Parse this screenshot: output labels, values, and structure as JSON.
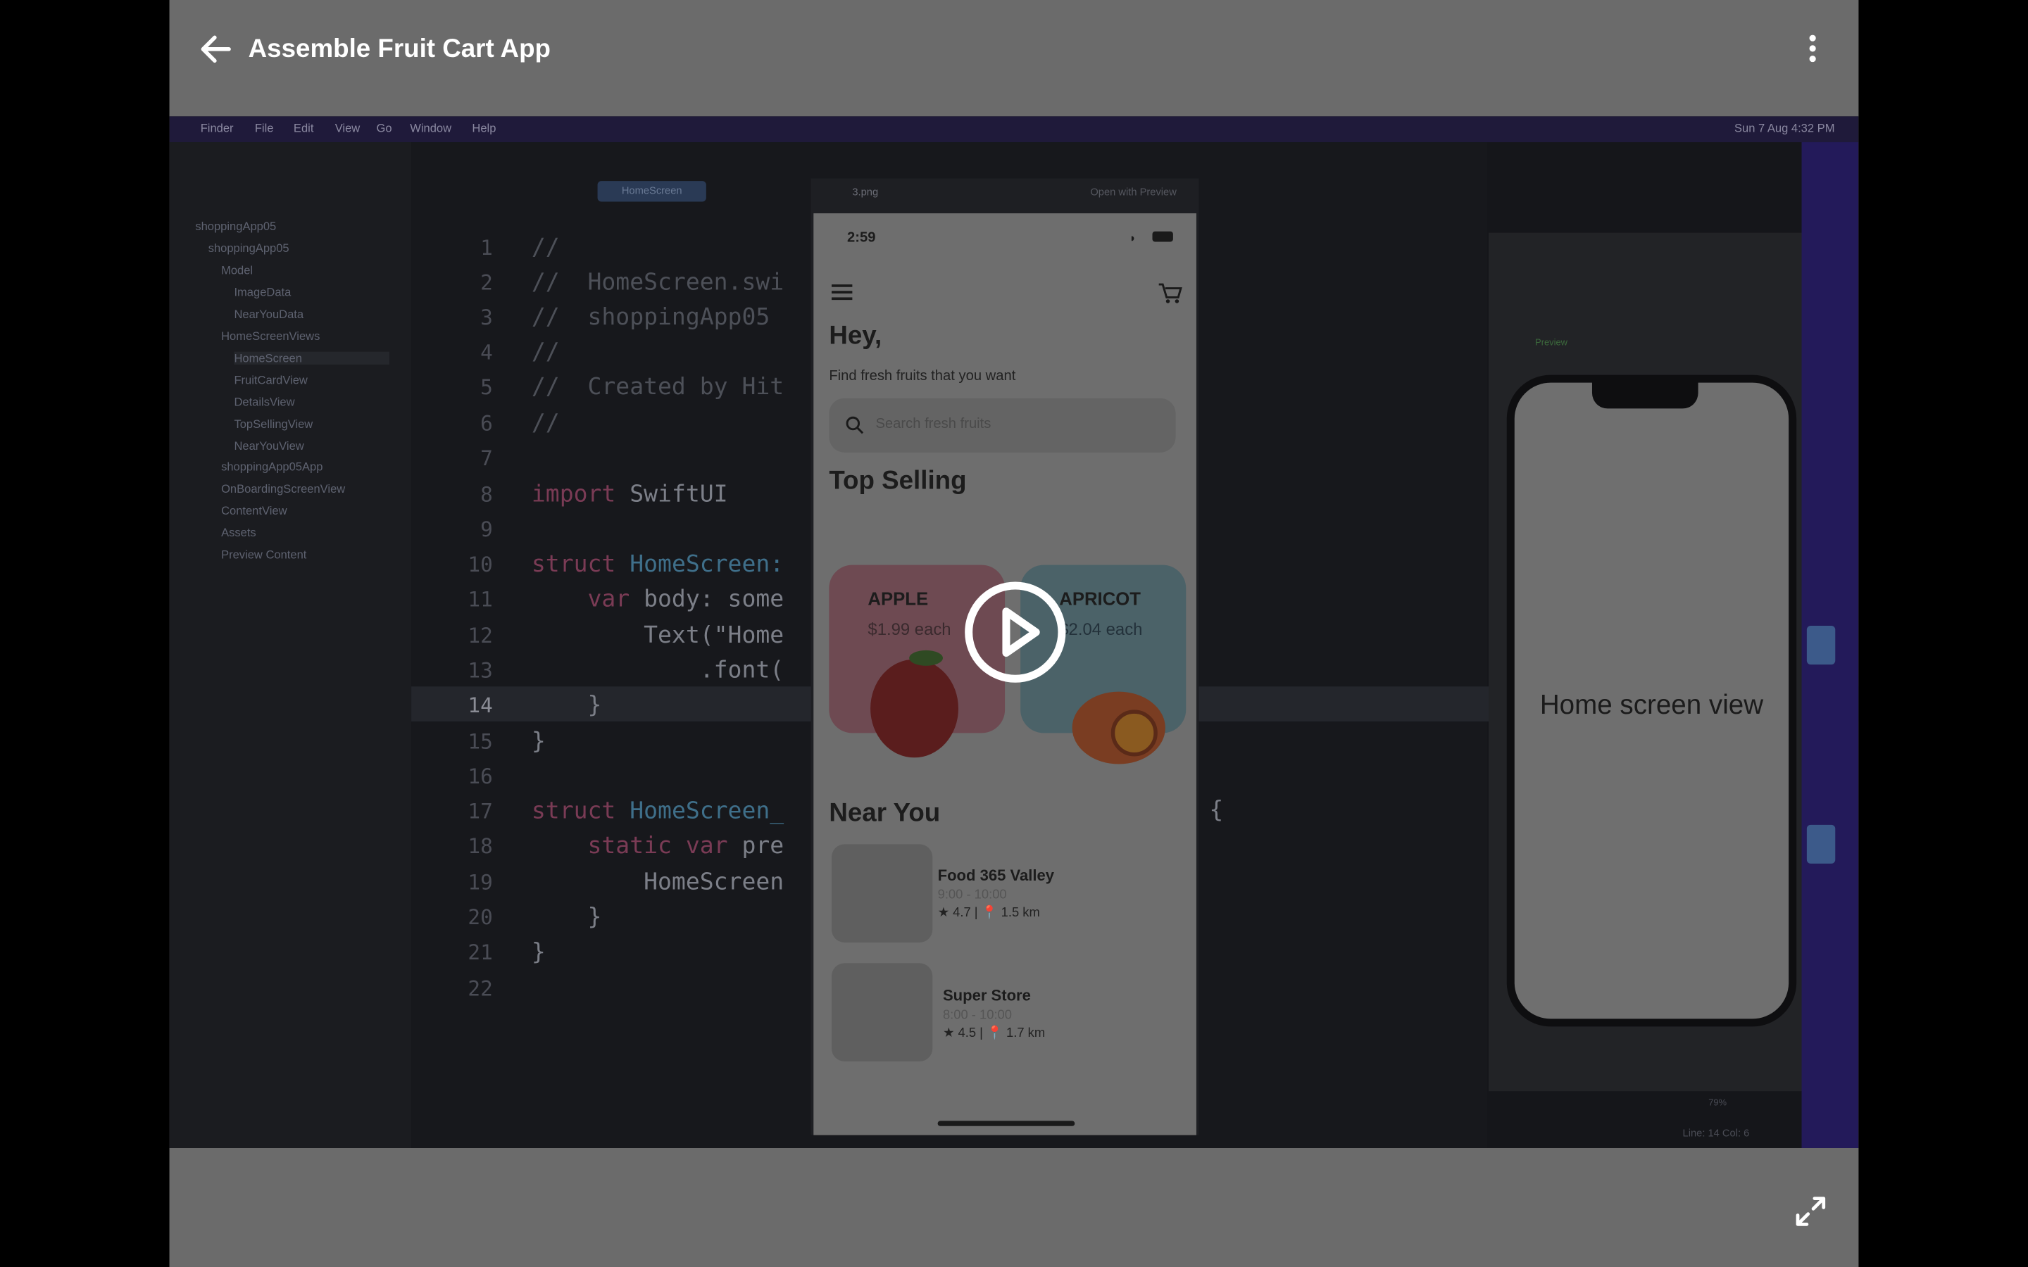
{
  "header": {
    "title": "Assemble Fruit Cart App"
  },
  "menubar": {
    "items": [
      "Finder",
      "File",
      "Edit",
      "View",
      "Go",
      "Window",
      "Help"
    ],
    "clock": "Sun 7 Aug 4:32 PM"
  },
  "navigator": {
    "items": [
      "shoppingApp05",
      "shoppingApp05",
      "Model",
      "ImageData",
      "NearYouData",
      "HomeScreenViews",
      "HomeScreen",
      "FruitCardView",
      "DetailsView",
      "TopSellingView",
      "NearYouView",
      "shoppingApp05App",
      "OnBoardingScreenView",
      "ContentView",
      "Assets",
      "Preview Content"
    ]
  },
  "editor": {
    "tab": "HomeScreen",
    "line_numbers": [
      "1",
      "2",
      "3",
      "4",
      "5",
      "6",
      "7",
      "8",
      "9",
      "10",
      "11",
      "12",
      "13",
      "14",
      "15",
      "16",
      "17",
      "18",
      "19",
      "20",
      "21",
      "22"
    ],
    "lines": {
      "l1": "//",
      "l2": "//  HomeScreen.swi",
      "l3": "//  shoppingApp05",
      "l4": "//",
      "l5": "//  Created by Hit",
      "l6": "//",
      "l8_kw": "import",
      "l8_rest": " SwiftUI",
      "l10_kw": "struct",
      "l10_rest": " HomeScreen:",
      "l11_kw": "    var",
      "l11_rest": " body: some",
      "l12": "        Text(\"Home",
      "l13": "            .font(",
      "l14": "    }",
      "l15": "}",
      "l17_kw": "struct",
      "l17_rest": " HomeScreen_",
      "l18_kw": "    static var",
      "l18_rest": " pre",
      "l19": "        HomeScreen",
      "l20": "    }",
      "l21": "}",
      "brace": "{"
    },
    "status": "Line: 14  Col: 6"
  },
  "preview": {
    "label": "Preview",
    "device_text": "Home screen view",
    "zoom": "79%"
  },
  "image_window": {
    "filename": "3.png",
    "open_with": "Open with Preview"
  },
  "phone": {
    "time": "2:59",
    "greeting": "Hey,",
    "subtitle": "Find fresh fruits that you want",
    "search_placeholder": "Search fresh fruits",
    "top_selling": "Top Selling",
    "cards": [
      {
        "name": "APPLE",
        "price": "$1.99 each"
      },
      {
        "name": "APRICOT",
        "price": "$2.04 each"
      }
    ],
    "near_you": "Near You",
    "stores": [
      {
        "name": "Food 365 Valley",
        "hours": "9:00 - 10:00",
        "meta": "★ 4.7 | 📍 1.5 km"
      },
      {
        "name": "Super Store",
        "hours": "8:00 - 10:00",
        "meta": "★ 4.5 | 📍 1.7 km"
      }
    ]
  },
  "colors": {
    "apple_card": "#6e4a52",
    "apricot_card": "#4b6268",
    "overlay": "#6b6b6b"
  }
}
